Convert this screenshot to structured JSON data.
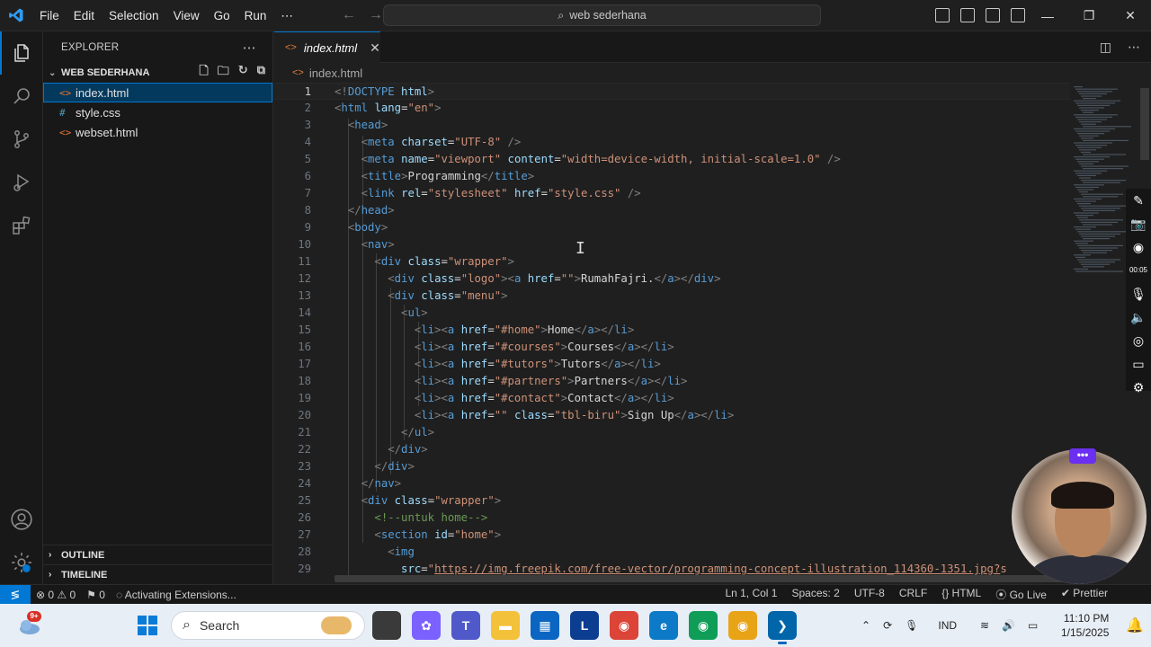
{
  "titlebar": {
    "menus": [
      "File",
      "Edit",
      "Selection",
      "View",
      "Go",
      "Run",
      "⋯"
    ],
    "search_text": "web sederhana"
  },
  "sidebar": {
    "title": "EXPLORER",
    "folder": "WEB SEDERHANA",
    "files": [
      {
        "name": "index.html",
        "icon": "<>",
        "color": "#e37933",
        "selected": true
      },
      {
        "name": "style.css",
        "icon": "#",
        "color": "#519aba",
        "selected": false
      },
      {
        "name": "webset.html",
        "icon": "<>",
        "color": "#e37933",
        "selected": false
      }
    ],
    "outline": "OUTLINE",
    "timeline": "TIMELINE"
  },
  "editor": {
    "tab": "index.html",
    "breadcrumb": "index.html",
    "active_line": 1
  },
  "code": [
    {
      "n": 1,
      "html": "<span class=\"p\">&lt;!</span><span class=\"t\">DOCTYPE</span> <span class=\"a\">html</span><span class=\"p\">&gt;</span>"
    },
    {
      "n": 2,
      "html": "<span class=\"p\">&lt;</span><span class=\"t\">html</span> <span class=\"a\">lang</span><span class=\"w\">=</span><span class=\"s\">\"en\"</span><span class=\"p\">&gt;</span>"
    },
    {
      "n": 3,
      "html": "  <span class=\"p\">&lt;</span><span class=\"t\">head</span><span class=\"p\">&gt;</span>"
    },
    {
      "n": 4,
      "html": "    <span class=\"p\">&lt;</span><span class=\"t\">meta</span> <span class=\"a\">charset</span><span class=\"w\">=</span><span class=\"s\">\"UTF-8\"</span> <span class=\"p\">/&gt;</span>"
    },
    {
      "n": 5,
      "html": "    <span class=\"p\">&lt;</span><span class=\"t\">meta</span> <span class=\"a\">name</span><span class=\"w\">=</span><span class=\"s\">\"viewport\"</span> <span class=\"a\">content</span><span class=\"w\">=</span><span class=\"s\">\"width=device-width, initial-scale=1.0\"</span> <span class=\"p\">/&gt;</span>"
    },
    {
      "n": 6,
      "html": "    <span class=\"p\">&lt;</span><span class=\"t\">title</span><span class=\"p\">&gt;</span><span class=\"w\">Programming</span><span class=\"p\">&lt;/</span><span class=\"t\">title</span><span class=\"p\">&gt;</span>"
    },
    {
      "n": 7,
      "html": "    <span class=\"p\">&lt;</span><span class=\"t\">link</span> <span class=\"a\">rel</span><span class=\"w\">=</span><span class=\"s\">\"stylesheet\"</span> <span class=\"a\">href</span><span class=\"w\">=</span><span class=\"s\">\"style.css\"</span> <span class=\"p\">/&gt;</span>"
    },
    {
      "n": 8,
      "html": "  <span class=\"p\">&lt;/</span><span class=\"t\">head</span><span class=\"p\">&gt;</span>"
    },
    {
      "n": 9,
      "html": "  <span class=\"p\">&lt;</span><span class=\"t\">body</span><span class=\"p\">&gt;</span>"
    },
    {
      "n": 10,
      "html": "    <span class=\"p\">&lt;</span><span class=\"t\">nav</span><span class=\"p\">&gt;</span>"
    },
    {
      "n": 11,
      "html": "      <span class=\"p\">&lt;</span><span class=\"t\">div</span> <span class=\"a\">class</span><span class=\"w\">=</span><span class=\"s\">\"wrapper\"</span><span class=\"p\">&gt;</span>"
    },
    {
      "n": 12,
      "html": "        <span class=\"p\">&lt;</span><span class=\"t\">div</span> <span class=\"a\">class</span><span class=\"w\">=</span><span class=\"s\">\"logo\"</span><span class=\"p\">&gt;&lt;</span><span class=\"t\">a</span> <span class=\"a\">href</span><span class=\"w\">=</span><span class=\"s\">\"\"</span><span class=\"p\">&gt;</span><span class=\"w\">RumahFajri.</span><span class=\"p\">&lt;/</span><span class=\"t\">a</span><span class=\"p\">&gt;&lt;/</span><span class=\"t\">div</span><span class=\"p\">&gt;</span>"
    },
    {
      "n": 13,
      "html": "        <span class=\"p\">&lt;</span><span class=\"t\">div</span> <span class=\"a\">class</span><span class=\"w\">=</span><span class=\"s\">\"menu\"</span><span class=\"p\">&gt;</span>"
    },
    {
      "n": 14,
      "html": "          <span class=\"p\">&lt;</span><span class=\"t\">ul</span><span class=\"p\">&gt;</span>"
    },
    {
      "n": 15,
      "html": "            <span class=\"p\">&lt;</span><span class=\"t\">li</span><span class=\"p\">&gt;&lt;</span><span class=\"t\">a</span> <span class=\"a\">href</span><span class=\"w\">=</span><span class=\"s\">\"#home\"</span><span class=\"p\">&gt;</span><span class=\"w\">Home</span><span class=\"p\">&lt;/</span><span class=\"t\">a</span><span class=\"p\">&gt;&lt;/</span><span class=\"t\">li</span><span class=\"p\">&gt;</span>"
    },
    {
      "n": 16,
      "html": "            <span class=\"p\">&lt;</span><span class=\"t\">li</span><span class=\"p\">&gt;&lt;</span><span class=\"t\">a</span> <span class=\"a\">href</span><span class=\"w\">=</span><span class=\"s\">\"#courses\"</span><span class=\"p\">&gt;</span><span class=\"w\">Courses</span><span class=\"p\">&lt;/</span><span class=\"t\">a</span><span class=\"p\">&gt;&lt;/</span><span class=\"t\">li</span><span class=\"p\">&gt;</span>"
    },
    {
      "n": 17,
      "html": "            <span class=\"p\">&lt;</span><span class=\"t\">li</span><span class=\"p\">&gt;&lt;</span><span class=\"t\">a</span> <span class=\"a\">href</span><span class=\"w\">=</span><span class=\"s\">\"#tutors\"</span><span class=\"p\">&gt;</span><span class=\"w\">Tutors</span><span class=\"p\">&lt;/</span><span class=\"t\">a</span><span class=\"p\">&gt;&lt;/</span><span class=\"t\">li</span><span class=\"p\">&gt;</span>"
    },
    {
      "n": 18,
      "html": "            <span class=\"p\">&lt;</span><span class=\"t\">li</span><span class=\"p\">&gt;&lt;</span><span class=\"t\">a</span> <span class=\"a\">href</span><span class=\"w\">=</span><span class=\"s\">\"#partners\"</span><span class=\"p\">&gt;</span><span class=\"w\">Partners</span><span class=\"p\">&lt;/</span><span class=\"t\">a</span><span class=\"p\">&gt;&lt;/</span><span class=\"t\">li</span><span class=\"p\">&gt;</span>"
    },
    {
      "n": 19,
      "html": "            <span class=\"p\">&lt;</span><span class=\"t\">li</span><span class=\"p\">&gt;&lt;</span><span class=\"t\">a</span> <span class=\"a\">href</span><span class=\"w\">=</span><span class=\"s\">\"#contact\"</span><span class=\"p\">&gt;</span><span class=\"w\">Contact</span><span class=\"p\">&lt;/</span><span class=\"t\">a</span><span class=\"p\">&gt;&lt;/</span><span class=\"t\">li</span><span class=\"p\">&gt;</span>"
    },
    {
      "n": 20,
      "html": "            <span class=\"p\">&lt;</span><span class=\"t\">li</span><span class=\"p\">&gt;&lt;</span><span class=\"t\">a</span> <span class=\"a\">href</span><span class=\"w\">=</span><span class=\"s\">\"\"</span> <span class=\"a\">class</span><span class=\"w\">=</span><span class=\"s\">\"tbl-biru\"</span><span class=\"p\">&gt;</span><span class=\"w\">Sign Up</span><span class=\"p\">&lt;/</span><span class=\"t\">a</span><span class=\"p\">&gt;&lt;/</span><span class=\"t\">li</span><span class=\"p\">&gt;</span>"
    },
    {
      "n": 21,
      "html": "          <span class=\"p\">&lt;/</span><span class=\"t\">ul</span><span class=\"p\">&gt;</span>"
    },
    {
      "n": 22,
      "html": "        <span class=\"p\">&lt;/</span><span class=\"t\">div</span><span class=\"p\">&gt;</span>"
    },
    {
      "n": 23,
      "html": "      <span class=\"p\">&lt;/</span><span class=\"t\">div</span><span class=\"p\">&gt;</span>"
    },
    {
      "n": 24,
      "html": "    <span class=\"p\">&lt;/</span><span class=\"t\">nav</span><span class=\"p\">&gt;</span>"
    },
    {
      "n": 25,
      "html": "    <span class=\"p\">&lt;</span><span class=\"t\">div</span> <span class=\"a\">class</span><span class=\"w\">=</span><span class=\"s\">\"wrapper\"</span><span class=\"p\">&gt;</span>"
    },
    {
      "n": 26,
      "html": "      <span class=\"c\">&lt;!--untuk home--&gt;</span>"
    },
    {
      "n": 27,
      "html": "      <span class=\"p\">&lt;</span><span class=\"t\">section</span> <span class=\"a\">id</span><span class=\"w\">=</span><span class=\"s\">\"home\"</span><span class=\"p\">&gt;</span>"
    },
    {
      "n": 28,
      "html": "        <span class=\"p\">&lt;</span><span class=\"t\">img</span>"
    },
    {
      "n": 29,
      "html": "          <span class=\"a\">src</span><span class=\"w\">=</span><span class=\"s\">\"</span><span class=\"u\">https://img.freepik.com/free-vector/programming-concept-illustration_114360-1351.jpg?</span><span class=\"s\">s</span>"
    }
  ],
  "recorder": {
    "time": "00:05"
  },
  "statusbar": {
    "errors": "⊗ 0 ⚠ 0",
    "ports": "⚑ 0",
    "activity": "Activating Extensions...",
    "position": "Ln 1, Col 1",
    "spaces": "Spaces: 2",
    "encoding": "UTF-8",
    "eol": "CRLF",
    "language": "{} HTML",
    "golive": "Go Live",
    "prettier": "✔ Prettier"
  },
  "taskbar": {
    "badge": "9+",
    "search_placeholder": "Search",
    "lang": "IND",
    "time": "11:10 PM",
    "date": "1/15/2025",
    "apps": [
      {
        "name": "file-explorer",
        "label": "",
        "color": "#3a3a3a"
      },
      {
        "name": "copilot",
        "label": "✿",
        "color": "#7b61ff"
      },
      {
        "name": "teams",
        "label": "T",
        "color": "#5059c9"
      },
      {
        "name": "folder",
        "label": "▬",
        "color": "#f3c13a"
      },
      {
        "name": "store",
        "label": "▦",
        "color": "#0a66c2"
      },
      {
        "name": "l-app",
        "label": "L",
        "color": "#0b3d91"
      },
      {
        "name": "chrome",
        "label": "◉",
        "color": "#db4437"
      },
      {
        "name": "edge",
        "label": "e",
        "color": "#0c7ac7"
      },
      {
        "name": "chrome-profile",
        "label": "◉",
        "color": "#0f9d58"
      },
      {
        "name": "chrome-alt",
        "label": "◉",
        "color": "#e8a317"
      },
      {
        "name": "vscode",
        "label": "❯",
        "color": "#0065a9"
      }
    ]
  }
}
